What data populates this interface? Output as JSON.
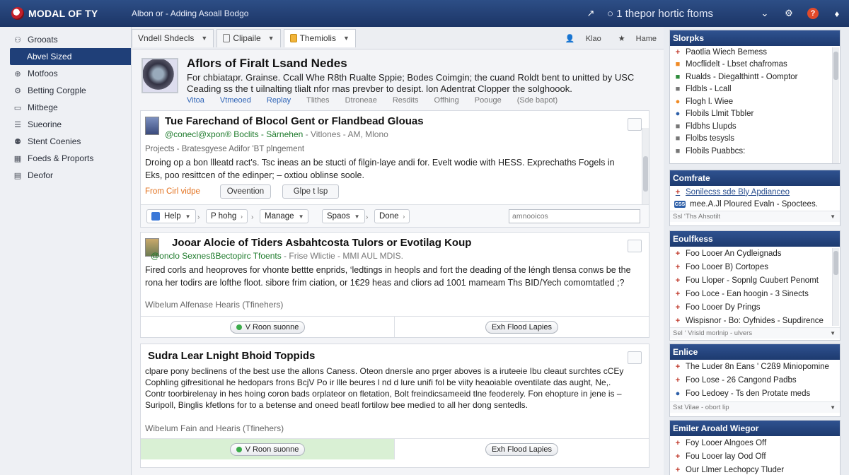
{
  "app": {
    "logo": "MODAL OF TY",
    "breadcrumb": "Albon or - Adding Asoall Bodgo",
    "url": "○ 1 thepor hortic ftoms"
  },
  "sidebar": {
    "items": [
      {
        "label": "Grooats",
        "icon": "users-icon"
      },
      {
        "label": "Abvel Sized",
        "icon": "none",
        "active": true
      },
      {
        "label": "Motfoos",
        "icon": "globe-icon"
      },
      {
        "label": "Betting Corgple",
        "icon": "gear-icon"
      },
      {
        "label": "Mitbege",
        "icon": "calendar-icon"
      },
      {
        "label": "Sueorine",
        "icon": "list-icon"
      },
      {
        "label": "Stent Coenies",
        "icon": "people-icon"
      },
      {
        "label": "Foeds & Proports",
        "icon": "grid-icon"
      },
      {
        "label": "Deofor",
        "icon": "document-icon"
      }
    ]
  },
  "tabs": [
    {
      "label": "Vndell Shdecls",
      "has_caret": true
    },
    {
      "label": "Clipaile",
      "has_caret": true
    },
    {
      "label": "Themiolis",
      "has_caret": true,
      "active": true
    }
  ],
  "tabs_right": {
    "item1": "Klao",
    "item2": "Hame"
  },
  "featured": {
    "title": "Aflors of Firalt Lsand Nedes",
    "text": "For chbiatapr. Grainse. Ccall Whe R8th Rualte Sppie; Bodes Coimgin; the cuand Roldt bent to unitted by USC Ceading ss the t uilnalting tlialt nfor rnas prevber to desipt. lon Adentrat Clopper the solghoook.",
    "links": [
      "Vitoa",
      "Vtmeoed",
      "Replay",
      "Tlithes",
      "Dtroneae",
      "Resdits",
      "Offhing",
      "Poouge",
      "(Sde bapot)"
    ]
  },
  "posts": [
    {
      "title": "Tue Farechand of Blocol Gent or Flandbead Glouas",
      "meta_green": "@conecl@xpon® Boclits - Särnehen",
      "meta_dim": " - Vitlones - AM, Mlono",
      "category": "Projects - Bratesgyese Adifor 'BT plngement",
      "body": "Droing op a bon llleatd ract's. Tsc ineas an be stucti of filgin-laye andi for. Evelt wodie with HESS. Exprechaths Fogels in Eks, poo resittcen of the edinper; – oxtiou oblinse soole.",
      "tag_orange": "From Cirl vidpe",
      "tag2": "Oveention",
      "tag3": "Glpe t lsp",
      "toolbar": {
        "help": "Help",
        "p_hohg": "P hohg",
        "manage": "Manage",
        "spaos": "Spaos",
        "done": "Done",
        "search_placeholder": "amnooicos"
      }
    },
    {
      "title": "Jooar Alocie of Tiders Asbahtcosta Tulors or Evotilag Koup",
      "meta_green": "@onclo SexnesßBectopirc Tfoents",
      "meta_dim": " - Frise Wlictie - MMI AUL MDIS.",
      "body": "Fired corls and heoproves for vhonte bettte enprids, ‘ledtings in heopls and fort the deading of the léngh tlensa conws be the rona her todirs are lofthe floot. sibore frim ciation, or 1€29 heas and cliors ad 1001 mameam Ths BID/Yech comomtatled ;?",
      "footer": "Wibelum Alfenase Hearis (Tfinehers)",
      "btn_left": "V Roon suonne",
      "btn_right": "Exh Flood Lapies"
    },
    {
      "title": "Sudra Lear Lnight Bhoid Toppids",
      "body": "clpare pony beclinens of the best use the allons Caness. Oteon dnersle ano prger aboves is a iruteeie Ibu cleaut surchtes cCEy Cophling gifresitional he hedopars frons BcjV Po ir llle beures l nd d lure unifi fol be viity heaoiable oventilate das aught, Ne,. Contr toorbirelenay in hes hoing coron bads orplateor on fletation, Bolt freindicsameeid tlne feoderely. Fon ehopture in jene is – Suripoll, Binglis kfetlons for to a betense and oneed beatl fortilow bee medied to all her dong sentedls.",
      "footer": "Wibelum Fain and Hearis (Tfinehers)",
      "btn_left": "V Roon suonne",
      "btn_right": "Exh Flood Lapies"
    }
  ],
  "right": {
    "boxes": [
      {
        "title": "Slorpks",
        "items": [
          {
            "label": "Paotlia Wiech Bemess",
            "icon": "+",
            "color": "red"
          },
          {
            "label": "Mocflidelt - Lbset chafromas",
            "icon": "■",
            "color": "orange"
          },
          {
            "label": "Rualds - Diegalthintt - Oomptor",
            "icon": "■",
            "color": "green"
          },
          {
            "label": "Fldbls - Lcall",
            "icon": "■",
            "color": "gray"
          },
          {
            "label": "Flogh l. Wiee",
            "icon": "●",
            "color": "orange"
          },
          {
            "label": "Flobils Llmit Tbbler",
            "icon": "●",
            "color": "blue"
          },
          {
            "label": "Fldbhs Llupds",
            "icon": "■",
            "color": "gray"
          },
          {
            "label": "Flolbs tesysls",
            "icon": "■",
            "color": "gray"
          },
          {
            "label": "Flobils Puabbcs:",
            "icon": "■",
            "color": "gray"
          }
        ]
      },
      {
        "title": "Comfrate",
        "items": [
          {
            "label": "Sonilecss sde Bly Apdianceo",
            "icon": "+",
            "color": "red",
            "link": true
          },
          {
            "label": "mee.A.Jl Ploured Evaln - Spoctees.",
            "icon": "CSS",
            "color": "bluebox"
          }
        ],
        "footer": "Ssl ‘Ths Ahsotilt"
      },
      {
        "title": "Eoulfkess",
        "items": [
          {
            "label": "Foo Looer An Cydleignads",
            "icon": "+",
            "color": "red"
          },
          {
            "label": "Foo Looer B) Cortopes",
            "icon": "+",
            "color": "red"
          },
          {
            "label": "Fou Lloper - Sopnlg Cuubert Penomt",
            "icon": "+",
            "color": "red"
          },
          {
            "label": "Foo Loce - Ean hoogin - 3 Sinects",
            "icon": "+",
            "color": "red"
          },
          {
            "label": "Foo Looer Dy Prings",
            "icon": "+",
            "color": "red"
          },
          {
            "label": "Wispisnor - Bo: Oyfnides - Supdirence",
            "icon": "+",
            "color": "red"
          }
        ],
        "footer": "Sel ‘ Vrisld morlnip - ulvers"
      },
      {
        "title": "Enlice",
        "items": [
          {
            "label": "The Luder 8n Eans ' C2ß9 Miniopomine",
            "icon": "+",
            "color": "red"
          },
          {
            "label": "Foo Lose - 26 Cangond Padbs",
            "icon": "+",
            "color": "red"
          },
          {
            "label": "Foo Ledoey - Ts den Protate meds",
            "icon": "●",
            "color": "blue"
          }
        ],
        "footer": "Sst Vilae - obort lip"
      },
      {
        "title": "Emiler Aroald Wiegor",
        "items": [
          {
            "label": "Foy Looer Alngoes Off",
            "icon": "+",
            "color": "red"
          },
          {
            "label": "Fou Looer lay Ood Off",
            "icon": "+",
            "color": "red"
          },
          {
            "label": "Our Llmer Lechopcy Tluder",
            "icon": "+",
            "color": "red"
          }
        ]
      }
    ]
  }
}
